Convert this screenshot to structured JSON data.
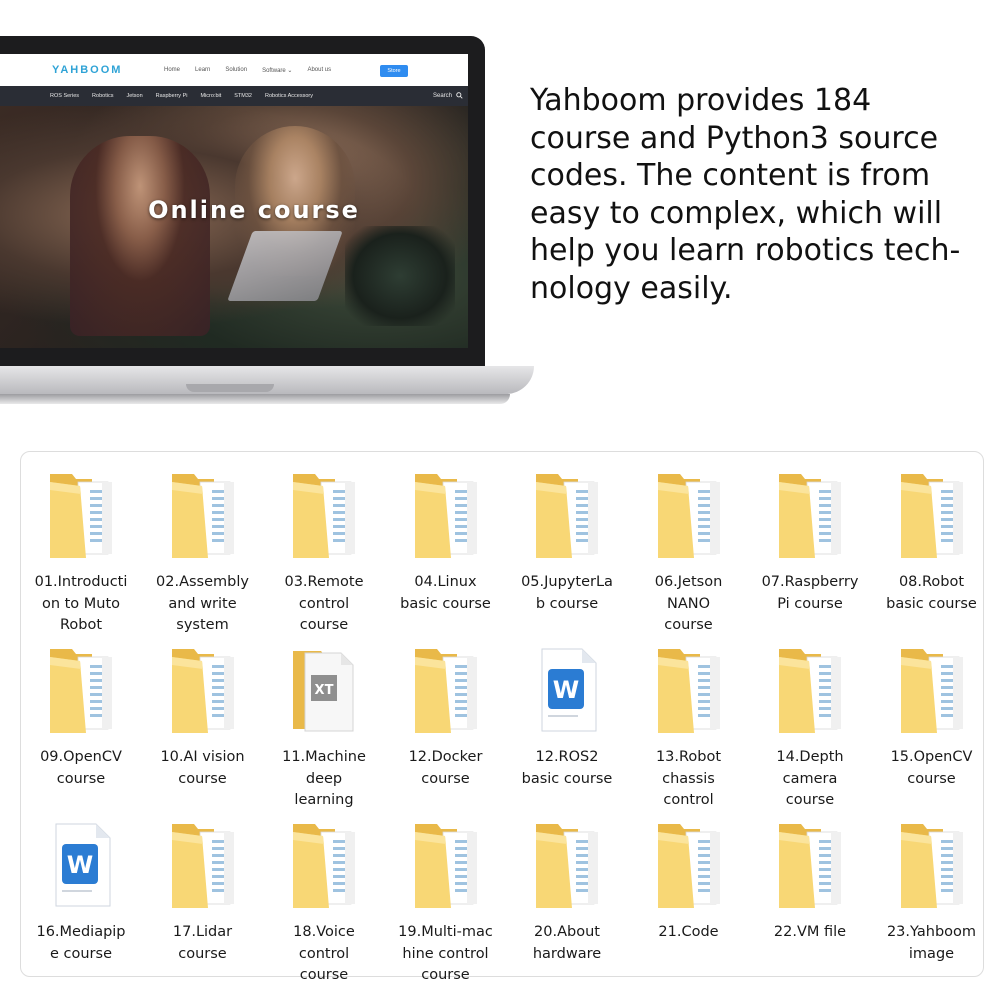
{
  "website": {
    "logo": "YAHBOOM",
    "nav": [
      "Home",
      "Learn",
      "Solution",
      "Software ⌄",
      "About us"
    ],
    "store_button": "Store",
    "subnav": [
      "ROS Series",
      "Robotics",
      "Jetson",
      "Raspberry Pi",
      "Micro:bit",
      "STM32",
      "Robotics Accessory"
    ],
    "search_label": "Search",
    "hero_title": "Online course"
  },
  "description": {
    "lines": [
      "Yahboom provides 184",
      "course and Python3 source",
      "codes. The content is from",
      "easy to complex, which will",
      "help you learn robotics tech-",
      "nology easily."
    ]
  },
  "courses": [
    {
      "label": "01.Introducti\non to Muto\nRobot",
      "icon": "folder-icon"
    },
    {
      "label": "02.Assembly\nand write\nsystem",
      "icon": "folder-icon"
    },
    {
      "label": "03.Remote\ncontrol\ncourse",
      "icon": "folder-icon"
    },
    {
      "label": "04.Linux\nbasic course",
      "icon": "folder-icon"
    },
    {
      "label": "05.JupyterLa\nb course",
      "icon": "folder-icon"
    },
    {
      "label": "06.Jetson\nNANO\ncourse",
      "icon": "folder-icon"
    },
    {
      "label": "07.Raspberry\nPi course",
      "icon": "folder-icon"
    },
    {
      "label": "08.Robot\nbasic course",
      "icon": "folder-icon"
    },
    {
      "label": "09.OpenCV\ncourse",
      "icon": "folder-icon"
    },
    {
      "label": "10.AI vision\ncourse",
      "icon": "folder-icon"
    },
    {
      "label": "11.Machine\ndeep\nlearning",
      "icon": "text-file-icon"
    },
    {
      "label": "12.Docker\ncourse",
      "icon": "folder-icon"
    },
    {
      "label": "12.ROS2\nbasic course",
      "icon": "word-doc-icon"
    },
    {
      "label": "13.Robot\nchassis\ncontrol",
      "icon": "folder-icon"
    },
    {
      "label": "14.Depth\ncamera\ncourse",
      "icon": "folder-icon"
    },
    {
      "label": "15.OpenCV\ncourse",
      "icon": "folder-icon"
    },
    {
      "label": "16.Mediapip\ne course",
      "icon": "word-doc-icon"
    },
    {
      "label": "17.Lidar\ncourse",
      "icon": "folder-icon"
    },
    {
      "label": "18.Voice\ncontrol\ncourse",
      "icon": "folder-icon"
    },
    {
      "label": "19.Multi-mac\nhine control\ncourse",
      "icon": "folder-icon"
    },
    {
      "label": "20.About\nhardware",
      "icon": "folder-icon"
    },
    {
      "label": "21.Code",
      "icon": "folder-icon"
    },
    {
      "label": "22.VM file",
      "icon": "folder-icon"
    },
    {
      "label": "23.Yahboom\nimage",
      "icon": "folder-icon"
    }
  ],
  "icon_glyphs": {
    "word_letter": "W",
    "text_letter": "XT"
  },
  "colors": {
    "folder": "#f8d775",
    "folder_dark": "#e9b949",
    "word_blue": "#2b7cd3",
    "brand": "#2fa3d6"
  }
}
